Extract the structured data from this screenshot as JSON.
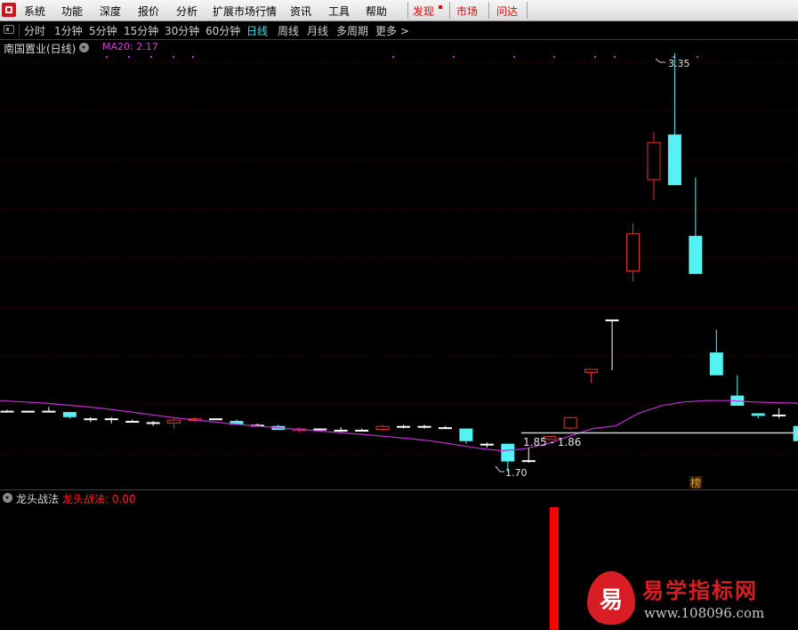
{
  "menubar": {
    "items": [
      "系统",
      "功能",
      "深度",
      "报价",
      "分析",
      "扩展市场行情",
      "资讯",
      "工具",
      "帮助"
    ],
    "right_items": [
      "发现",
      "市场",
      "问达"
    ]
  },
  "period_bar": {
    "items": [
      "分时",
      "1分钟",
      "5分钟",
      "15分钟",
      "30分钟",
      "60分钟",
      "日线",
      "周线",
      "月线",
      "多周期",
      "更多 >"
    ],
    "active": "日线"
  },
  "main_chart": {
    "stock_title": "南国置业(日线)",
    "ma_label": "MA20: 2.17"
  },
  "indicator_panel": {
    "title": "龙头战法",
    "value_label": "龙头战法: 0.00"
  },
  "watermark": {
    "logo_char": "易",
    "title": "易学指标网",
    "url": "www.108096.com"
  },
  "colors": {
    "up": "#e0342e",
    "down": "#54f2f2",
    "ma": "#c030d0",
    "signal": "#ff0000",
    "grid": "#5a0000"
  },
  "chart_data": {
    "type": "candlestick",
    "series_name": "南国置业",
    "period": "日线",
    "candles": [
      {
        "o": 1.94,
        "h": 1.945,
        "l": 1.94,
        "c": 1.94
      },
      {
        "o": 1.935,
        "h": 1.94,
        "l": 1.935,
        "c": 1.94
      },
      {
        "o": 1.935,
        "h": 1.955,
        "l": 1.935,
        "c": 1.94
      },
      {
        "o": 1.935,
        "h": 1.935,
        "l": 1.91,
        "c": 1.915
      },
      {
        "o": 1.91,
        "h": 1.915,
        "l": 1.895,
        "c": 1.91
      },
      {
        "o": 1.91,
        "h": 1.915,
        "l": 1.89,
        "c": 1.91
      },
      {
        "o": 1.9,
        "h": 1.905,
        "l": 1.895,
        "c": 1.9
      },
      {
        "o": 1.895,
        "h": 1.9,
        "l": 1.88,
        "c": 1.895
      },
      {
        "o": 1.89,
        "h": 1.91,
        "l": 1.87,
        "c": 1.905
      },
      {
        "o": 1.9,
        "h": 1.915,
        "l": 1.895,
        "c": 1.91
      },
      {
        "o": 1.91,
        "h": 1.91,
        "l": 1.905,
        "c": 1.905
      },
      {
        "o": 1.9,
        "h": 1.905,
        "l": 1.885,
        "c": 1.885
      },
      {
        "o": 1.885,
        "h": 1.89,
        "l": 1.88,
        "c": 1.885
      },
      {
        "o": 1.88,
        "h": 1.885,
        "l": 1.865,
        "c": 1.865
      },
      {
        "o": 1.86,
        "h": 1.875,
        "l": 1.855,
        "c": 1.87
      },
      {
        "o": 1.87,
        "h": 1.87,
        "l": 1.86,
        "c": 1.865
      },
      {
        "o": 1.86,
        "h": 1.875,
        "l": 1.855,
        "c": 1.865
      },
      {
        "o": 1.865,
        "h": 1.87,
        "l": 1.86,
        "c": 1.865
      },
      {
        "o": 1.865,
        "h": 1.885,
        "l": 1.86,
        "c": 1.88
      },
      {
        "o": 1.875,
        "h": 1.885,
        "l": 1.87,
        "c": 1.88
      },
      {
        "o": 1.88,
        "h": 1.885,
        "l": 1.87,
        "c": 1.875
      },
      {
        "o": 1.875,
        "h": 1.88,
        "l": 1.87,
        "c": 1.875
      },
      {
        "o": 1.87,
        "h": 1.87,
        "l": 1.81,
        "c": 1.82
      },
      {
        "o": 1.81,
        "h": 1.815,
        "l": 1.795,
        "c": 1.81
      },
      {
        "o": 1.81,
        "h": 1.81,
        "l": 1.7,
        "c": 1.74
      },
      {
        "o": 1.74,
        "h": 1.795,
        "l": 1.735,
        "c": 1.745
      },
      {
        "o": 1.825,
        "h": 1.84,
        "l": 1.825,
        "c": 1.84
      },
      {
        "o": 1.87,
        "h": 1.915,
        "l": 1.865,
        "c": 1.915
      },
      {
        "o": 2.09,
        "h": 2.1,
        "l": 2.05,
        "c": 2.105
      },
      {
        "o": 2.3,
        "h": 2.3,
        "l": 2.1,
        "c": 2.3
      },
      {
        "o": 2.49,
        "h": 2.68,
        "l": 2.45,
        "c": 2.64
      },
      {
        "o": 2.85,
        "h": 3.04,
        "l": 2.77,
        "c": 3.0
      },
      {
        "o": 3.03,
        "h": 3.35,
        "l": 2.86,
        "c": 2.83
      },
      {
        "o": 2.63,
        "h": 2.86,
        "l": 2.48,
        "c": 2.48
      },
      {
        "o": 2.17,
        "h": 2.26,
        "l": 2.08,
        "c": 2.08
      },
      {
        "o": 2.0,
        "h": 2.08,
        "l": 1.97,
        "c": 1.96
      },
      {
        "o": 1.93,
        "h": 1.93,
        "l": 1.91,
        "c": 1.92
      },
      {
        "o": 1.92,
        "h": 1.95,
        "l": 1.91,
        "c": 1.925
      },
      {
        "o": 1.88,
        "h": 1.9,
        "l": 1.855,
        "c": 1.82
      },
      {
        "o": 1.86,
        "h": 1.86,
        "l": 1.86,
        "c": 1.86
      }
    ],
    "ma20": [
      1.98,
      1.975,
      1.97,
      1.962,
      1.954,
      1.944,
      1.932,
      1.92,
      1.909,
      1.9,
      1.89,
      1.882,
      1.874,
      1.867,
      1.86,
      1.853,
      1.846,
      1.838,
      1.83,
      1.82,
      1.806,
      1.792,
      1.782,
      1.79,
      1.81,
      1.84,
      1.87,
      1.88,
      1.93,
      1.96,
      1.975,
      1.98,
      1.98,
      1.975,
      1.972,
      1.97
    ],
    "annotations": {
      "high_label": "3.35",
      "low_label": "1.70",
      "range_label": "1.85 - 1.86",
      "bang_label": "榜"
    },
    "indicator": {
      "name": "龙头战法",
      "signals": [
        1,
        0
      ]
    }
  }
}
